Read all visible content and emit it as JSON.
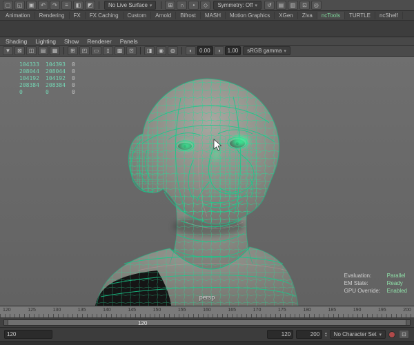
{
  "status_line": {
    "icons_left": [
      {
        "name": "new-scene-icon",
        "glyph": "▢"
      },
      {
        "name": "open-scene-icon",
        "glyph": "◱"
      },
      {
        "name": "save-scene-icon",
        "glyph": "▣"
      },
      {
        "name": "undo-icon",
        "glyph": "↶"
      },
      {
        "name": "redo-icon",
        "glyph": "↷"
      },
      {
        "name": "select-by-hierarchy-icon",
        "glyph": "≡"
      },
      {
        "name": "select-by-object-icon",
        "glyph": "◧"
      },
      {
        "name": "select-by-component-icon",
        "glyph": "◩"
      }
    ],
    "live_surface_label": "No Live Surface",
    "snap_icons": [
      {
        "name": "snap-to-grid-icon",
        "glyph": "⊞"
      },
      {
        "name": "snap-to-curve-icon",
        "glyph": "∩"
      },
      {
        "name": "snap-to-point-icon",
        "glyph": "•"
      },
      {
        "name": "snap-to-plane-icon",
        "glyph": "◇"
      }
    ],
    "symmetry_label": "Symmetry: Off",
    "icons_right": [
      {
        "name": "construction-history-icon",
        "glyph": "↺"
      },
      {
        "name": "render-current-frame-icon",
        "glyph": "▤"
      },
      {
        "name": "ipr-render-icon",
        "glyph": "▥"
      },
      {
        "name": "render-settings-icon",
        "glyph": "⊡"
      },
      {
        "name": "paint-effects-icon",
        "glyph": "◎"
      }
    ]
  },
  "shelf": {
    "tabs": [
      {
        "label": "Animation"
      },
      {
        "label": "Rendering"
      },
      {
        "label": "FX"
      },
      {
        "label": "FX Caching"
      },
      {
        "label": "Custom"
      },
      {
        "label": "Arnold"
      },
      {
        "label": "Bifrost"
      },
      {
        "label": "MASH"
      },
      {
        "label": "Motion Graphics"
      },
      {
        "label": "XGen"
      },
      {
        "label": "Ziva"
      },
      {
        "label": "ncTools"
      },
      {
        "label": "TURTLE"
      },
      {
        "label": "ncShelf"
      }
    ]
  },
  "panel_menus": {
    "items": [
      "Shading",
      "Lighting",
      "Show",
      "Renderer",
      "Panels"
    ]
  },
  "viewport_toolbar": {
    "icons": [
      {
        "name": "select-camera-icon",
        "glyph": "▼"
      },
      {
        "name": "lock-camera-icon",
        "glyph": "⊠"
      },
      {
        "name": "camera-attributes-icon",
        "glyph": "◫"
      },
      {
        "name": "bookmarks-icon",
        "glyph": "▤"
      },
      {
        "name": "image-plane-icon",
        "glyph": "▦"
      },
      {
        "name": "2d-pan-zoom-icon",
        "glyph": "⊞"
      },
      {
        "name": "overscan-settings-icon",
        "glyph": "◰"
      },
      {
        "name": "film-gate-icon",
        "glyph": "▭"
      },
      {
        "name": "resolution-gate-icon",
        "glyph": "▯"
      },
      {
        "name": "gate-mask-icon",
        "glyph": "▩"
      },
      {
        "name": "field-chart-icon",
        "glyph": "⊡"
      },
      {
        "name": "safe-action-icon",
        "glyph": "◨"
      },
      {
        "name": "wireframe-on-shaded-icon",
        "glyph": "◉"
      },
      {
        "name": "xray-icon",
        "glyph": "◍"
      }
    ],
    "exposure_icon_glyph": "◐",
    "exposure_value": "0.00",
    "gamma_icon_glyph": "◑",
    "gamma_value": "1.00",
    "view_transform": "sRGB gamma"
  },
  "viewport": {
    "camera_label": "persp",
    "wireframe_color": "#2bd796",
    "poly_count_hud": {
      "rows": [
        [
          "104333",
          "104393",
          "0"
        ],
        [
          "208044",
          "208044",
          "0"
        ],
        [
          "104192",
          "104192",
          "0"
        ],
        [
          "208384",
          "208384",
          "0"
        ],
        [
          "0",
          "0",
          "0"
        ]
      ]
    },
    "evaluation_hud": {
      "rows": [
        {
          "label": "Evaluation:",
          "value": "Parallel"
        },
        {
          "label": "EM State:",
          "value": "Ready"
        },
        {
          "label": "GPU Override:",
          "value": "Enabled"
        }
      ]
    }
  },
  "time_slider": {
    "tick_labels": [
      "120",
      "125",
      "130",
      "135",
      "140",
      "145",
      "150",
      "155",
      "160",
      "165",
      "170",
      "175",
      "180",
      "185",
      "190",
      "195",
      "200"
    ]
  },
  "range_slider": {
    "start_label": "120"
  },
  "playback_controls": {
    "current_frame": "120",
    "playback_start": "120",
    "playback_end": "200",
    "character_set_label": "No Character Set"
  }
}
